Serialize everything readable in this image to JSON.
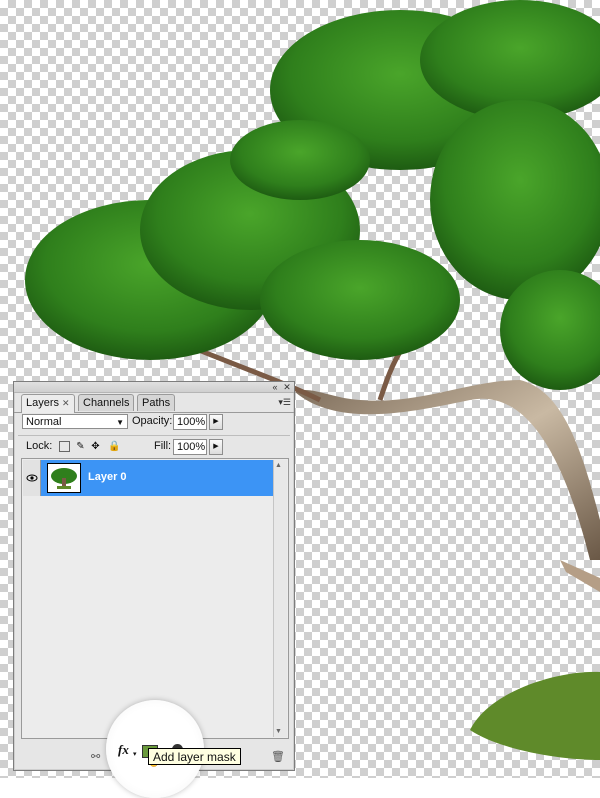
{
  "panel": {
    "tabs": [
      {
        "label": "Layers",
        "active": true
      },
      {
        "label": "Channels",
        "active": false
      },
      {
        "label": "Paths",
        "active": false
      }
    ],
    "blend_mode": "Normal",
    "opacity_label": "Opacity:",
    "opacity_value": "100%",
    "lock_label": "Lock:",
    "fill_label": "Fill:",
    "fill_value": "100%",
    "layers": [
      {
        "name": "Layer 0",
        "selected": true,
        "visible": true
      }
    ],
    "footer_icons": [
      "link-icon",
      "fx-icon",
      "layer-mask-icon",
      "adjustment-icon",
      "group-icon",
      "new-layer-icon",
      "trash-icon"
    ],
    "tooltip": "Add layer mask",
    "selection_color": "#3c94f5"
  }
}
